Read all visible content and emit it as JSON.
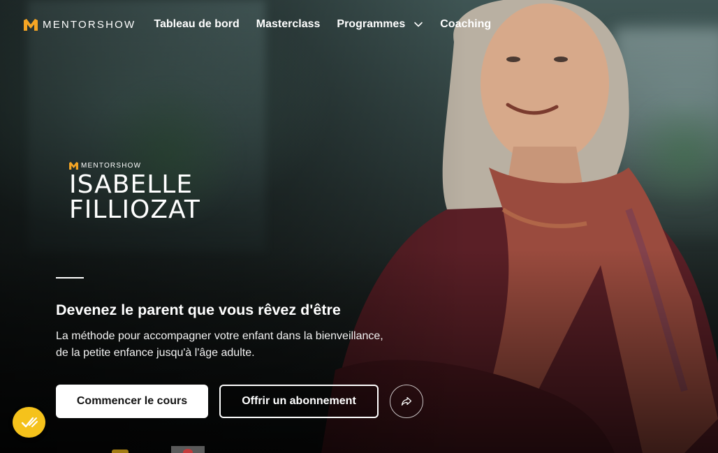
{
  "nav": {
    "logo_text": "MENTORSHOW",
    "items": [
      {
        "label": "Tableau de bord"
      },
      {
        "label": "Masterclass"
      },
      {
        "label": "Programmes",
        "has_dropdown": true
      },
      {
        "label": "Coaching"
      }
    ]
  },
  "course": {
    "brand_small": "MENTORSHOW",
    "name_line1": "ISABELLE",
    "name_line2": "FILLIOZAT",
    "headline": "Devenez le parent que vous rêvez d'être",
    "description_line1": "La méthode pour accompagner votre enfant dans la bienveillance,",
    "description_line2": "de la petite enfance jusqu'à l'âge adulte."
  },
  "actions": {
    "start_label": "Commencer le cours",
    "gift_label": "Offrir un abonnement",
    "share_icon": "share-icon"
  },
  "widget": {
    "icon": "checklist-icon",
    "color": "#f5c21b"
  },
  "colors": {
    "brand_accent": "#f5a524",
    "primary_button": "#ffffff",
    "text": "#ffffff"
  }
}
